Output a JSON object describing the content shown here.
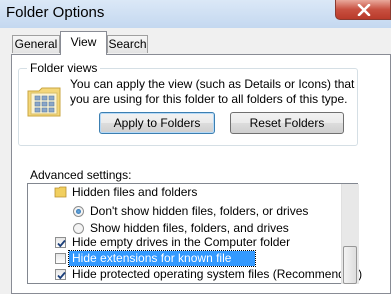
{
  "window": {
    "title": "Folder Options"
  },
  "tabs": [
    {
      "label": "General",
      "active": false
    },
    {
      "label": "View",
      "active": true
    },
    {
      "label": "Search",
      "active": false
    }
  ],
  "folder_views": {
    "group_title": "Folder views",
    "description": "You can apply the view (such as Details or Icons) that you are using for this folder to all folders of this type.",
    "apply_button": "Apply to Folders",
    "reset_button": "Reset Folders"
  },
  "advanced": {
    "label": "Advanced settings:",
    "items": [
      {
        "type": "folder",
        "label": "Hidden files and folders"
      },
      {
        "type": "radio",
        "label": "Don't show hidden files, folders, or drives",
        "checked": true
      },
      {
        "type": "radio",
        "label": "Show hidden files, folders, and drives",
        "checked": false
      },
      {
        "type": "checkbox",
        "label": "Hide empty drives in the Computer folder",
        "checked": true
      },
      {
        "type": "checkbox",
        "label": "Hide extensions for known file types",
        "checked": false,
        "selected": true
      },
      {
        "type": "checkbox",
        "label": "Hide protected operating system files (Recommended)",
        "checked": true
      }
    ]
  },
  "colors": {
    "selection": "#3399ff",
    "title_bar": "#c4d8f0",
    "close_button": "#c85040"
  }
}
